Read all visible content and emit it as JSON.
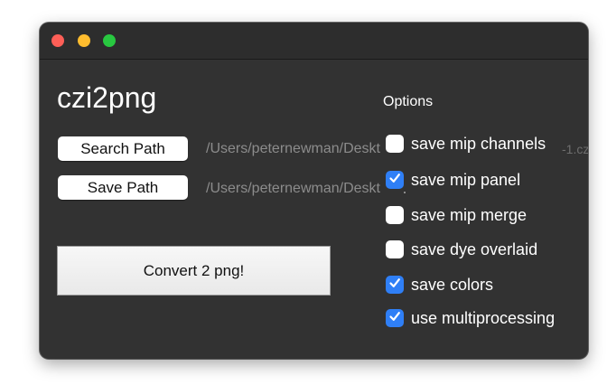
{
  "window": {
    "traffic_lights": [
      "close",
      "minimize",
      "zoom"
    ]
  },
  "app": {
    "title": "czi2png"
  },
  "search": {
    "button_label": "Search Path",
    "path_text": "/Users/peternewman/Desktop"
  },
  "save": {
    "button_label": "Save Path",
    "path_text": "/Users/peternewman/Desktop"
  },
  "convert": {
    "button_label": "Convert 2 png!"
  },
  "options": {
    "heading": "Options",
    "peek_text": "-1.cz",
    "items": [
      {
        "label": "save mip channels",
        "checked": false
      },
      {
        "label": "save mip panel",
        "checked": true
      },
      {
        "label": "save mip merge",
        "checked": false
      },
      {
        "label": "save dye overlaid",
        "checked": false
      },
      {
        "label": "save colors",
        "checked": true
      },
      {
        "label": "use multiprocessing",
        "checked": true
      }
    ]
  },
  "colors": {
    "window_bg": "#323232",
    "checkbox_accent": "#2f7ff6",
    "close": "#fe5f57",
    "minimize": "#febc2e",
    "zoom": "#28c840"
  }
}
